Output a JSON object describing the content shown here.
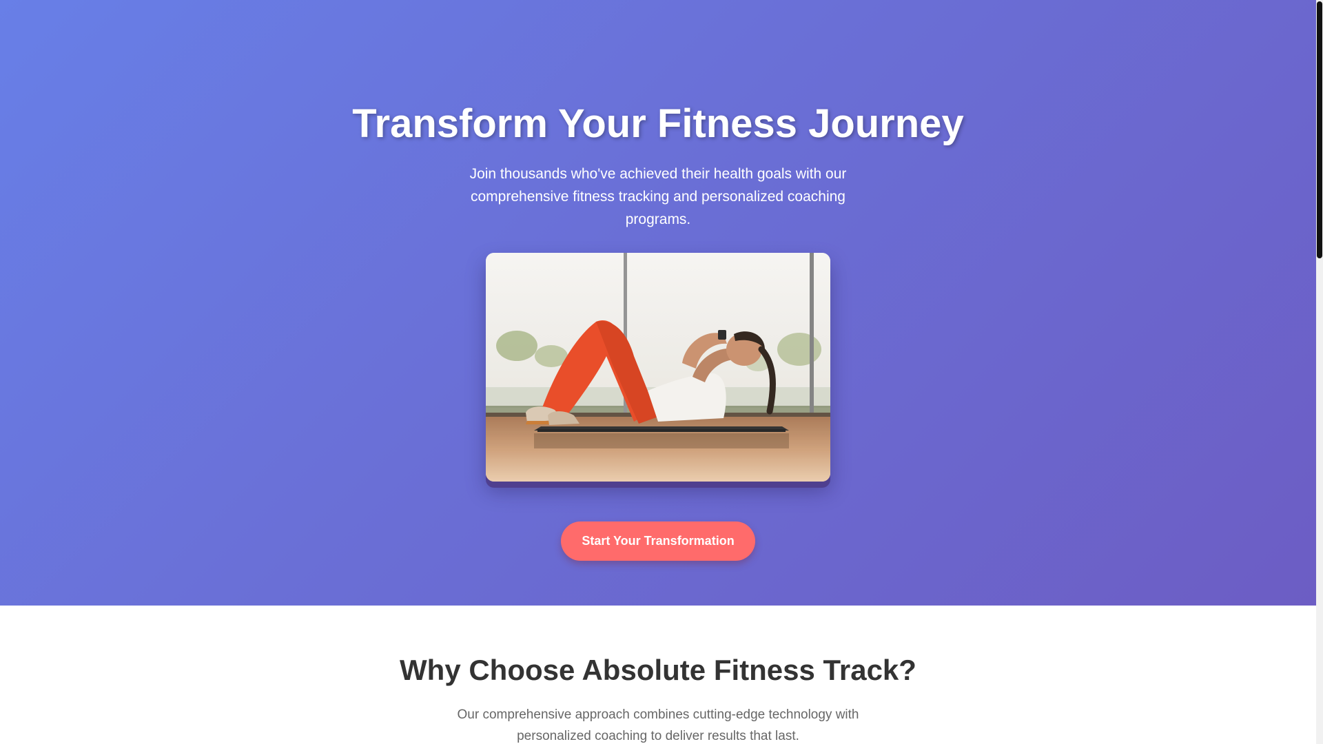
{
  "hero": {
    "title": "Transform Your Fitness Journey",
    "subtitle": "Join thousands who've achieved their health goals with our comprehensive fitness tracking and personalized coaching programs.",
    "image_alt": "Woman doing crunches on a yoga mat in a bright gym",
    "cta_label": "Start Your Transformation",
    "gradient_start": "#687fe7",
    "gradient_end": "#6c5dc4",
    "cta_color": "#ff6b6b"
  },
  "features": {
    "title": "Why Choose Absolute Fitness Track?",
    "subtitle": "Our comprehensive approach combines cutting-edge technology with personalized coaching to deliver results that last."
  }
}
